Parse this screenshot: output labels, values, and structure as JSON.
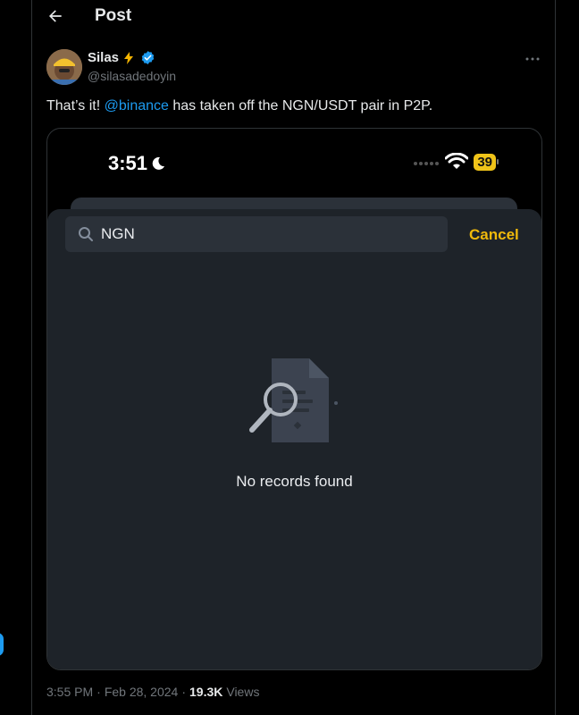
{
  "header": {
    "title": "Post",
    "back_icon": "arrow-left-icon"
  },
  "author": {
    "display_name": "Silas",
    "handle": "@silasadedoyin",
    "badge_emoji": "lightning-bolt-icon",
    "verified": true
  },
  "tweet": {
    "text_before": "That’s it! ",
    "mention": "@binance",
    "text_after": " has taken off the NGN/USDT pair in P2P."
  },
  "screenshot": {
    "status_time": "3:51",
    "battery_level": "39",
    "search_value": "NGN",
    "cancel_label": "Cancel",
    "empty_message": "No records found"
  },
  "meta": {
    "time": "3:55 PM",
    "separator": "·",
    "date": "Feb 28, 2024",
    "views_count": "19.3K",
    "views_label": "Views"
  },
  "colors": {
    "background": "#000000",
    "accent_blue": "#1d9bf0",
    "binance_yellow": "#f0b90b",
    "muted_text": "#71767b"
  }
}
